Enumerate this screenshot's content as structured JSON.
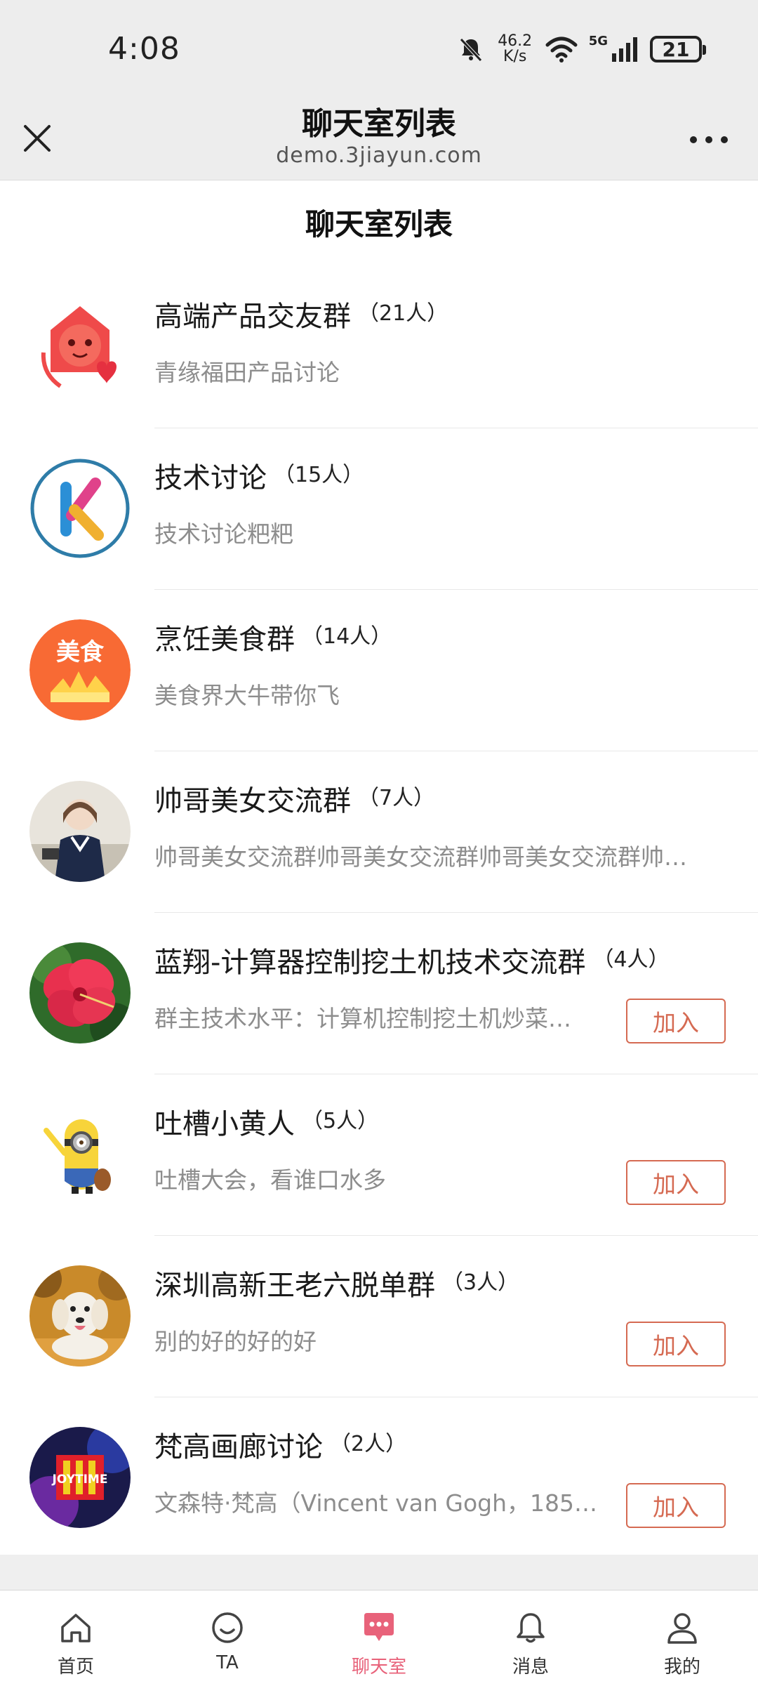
{
  "status_bar": {
    "time": "4:08",
    "net_speed_value": "46.2",
    "net_speed_unit": "K/s",
    "signal_type": "5G",
    "battery": "21"
  },
  "webview_header": {
    "title": "聊天室列表",
    "url": "demo.3jiayun.com"
  },
  "page": {
    "heading": "聊天室列表"
  },
  "rooms": [
    {
      "name": "高端产品交友群",
      "count": "（21人）",
      "desc": "青缘福田产品讨论",
      "avatar": "red-cartoon-logo-avatar"
    },
    {
      "name": "技术讨论",
      "count": "（15人）",
      "desc": "技术讨论粑粑",
      "avatar": "letter-k-logo-avatar"
    },
    {
      "name": "烹饪美食群",
      "count": "（14人）",
      "desc": "美食界大牛带你飞",
      "avatar": "food-logo-avatar",
      "avatar_text": "美食"
    },
    {
      "name": "帅哥美女交流群",
      "count": "（7人）",
      "desc": "帅哥美女交流群帅哥美女交流群帅哥美女交流群帅…",
      "avatar": "girl-photo-avatar"
    },
    {
      "name": "蓝翔-计算器控制挖土机技术交流群",
      "count": "（4人）",
      "desc": "群主技术水平：计算机控制挖土机炒菜…",
      "avatar": "flower-photo-avatar",
      "join": "加入"
    },
    {
      "name": "吐槽小黄人",
      "count": "（5人）",
      "desc": "吐槽大会，看谁口水多",
      "avatar": "minion-avatar",
      "join": "加入"
    },
    {
      "name": "深圳高新王老六脱单群",
      "count": "（3人）",
      "desc": "别的好的好的好",
      "avatar": "dog-photo-avatar",
      "join": "加入"
    },
    {
      "name": "梵高画廊讨论",
      "count": "（2人）",
      "desc": "文森特·梵高（Vincent van Gogh，185…",
      "avatar": "joytime-logo-avatar",
      "avatar_text": "JOYTIME",
      "join": "加入"
    }
  ],
  "tabbar": {
    "tabs": [
      {
        "label": "首页",
        "icon": "home-icon"
      },
      {
        "label": "TA",
        "icon": "smile-icon"
      },
      {
        "label": "聊天室",
        "icon": "chat-bubble-icon",
        "active": true
      },
      {
        "label": "消息",
        "icon": "bell-icon"
      },
      {
        "label": "我的",
        "icon": "person-icon"
      }
    ]
  },
  "colors": {
    "accent_pink": "#e8627a",
    "join_button": "#d56a52",
    "header_bg": "#ededed"
  }
}
